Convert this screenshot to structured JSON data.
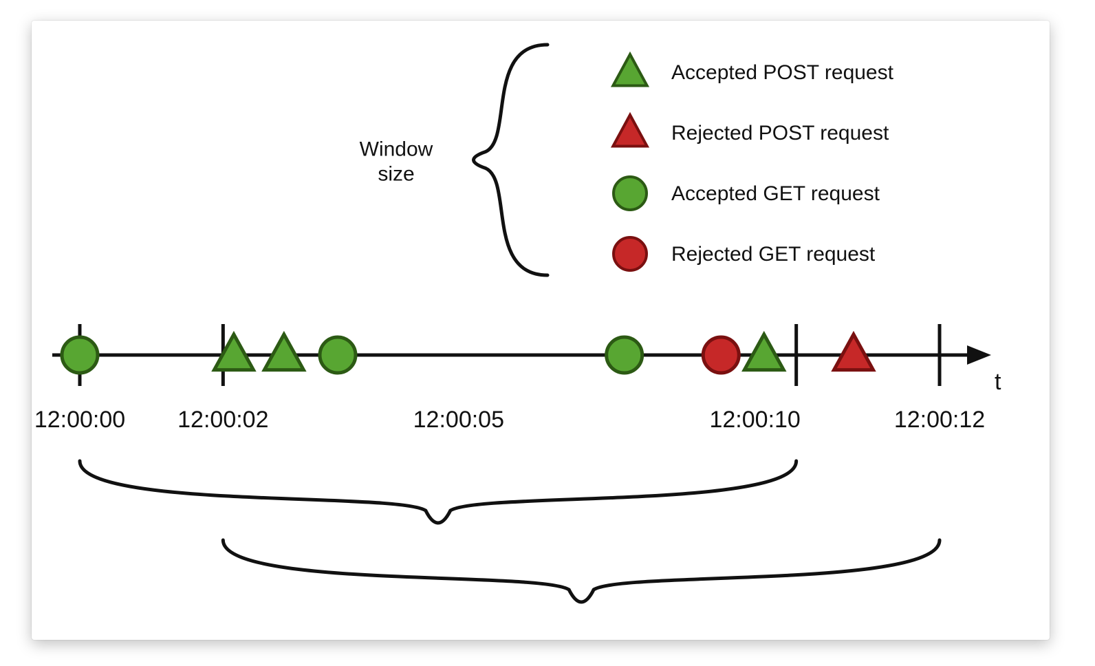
{
  "brace_label_line1": "Window",
  "brace_label_line2": "size",
  "axis_label": "t",
  "legend": [
    {
      "label": "Accepted POST request",
      "shape": "triangle",
      "fill": "#58a632",
      "stroke": "#2c5a14"
    },
    {
      "label": "Rejected POST request",
      "shape": "triangle",
      "fill": "#c62828",
      "stroke": "#7a1010"
    },
    {
      "label": "Accepted GET request",
      "shape": "circle",
      "fill": "#58a632",
      "stroke": "#2c5a14"
    },
    {
      "label": "Rejected GET request",
      "shape": "circle",
      "fill": "#c62828",
      "stroke": "#7a1010"
    }
  ],
  "ticks": [
    {
      "t": 0,
      "label": "12:00:00",
      "major": true
    },
    {
      "t": 2,
      "label": "12:00:02",
      "major": true
    },
    {
      "t": 5,
      "label": "12:00:05",
      "major": false
    },
    {
      "t": 10,
      "label": "12:00:10",
      "major": true
    },
    {
      "t": 12,
      "label": "12:00:12",
      "major": true
    }
  ],
  "events": [
    {
      "t": 0.0,
      "shape": "circle",
      "status": "accepted",
      "name": "get-accepted-1"
    },
    {
      "t": 2.15,
      "shape": "triangle",
      "status": "accepted",
      "name": "post-accepted-1"
    },
    {
      "t": 2.85,
      "shape": "triangle",
      "status": "accepted",
      "name": "post-accepted-2"
    },
    {
      "t": 3.6,
      "shape": "circle",
      "status": "accepted",
      "name": "get-accepted-2"
    },
    {
      "t": 7.6,
      "shape": "circle",
      "status": "accepted",
      "name": "get-accepted-3"
    },
    {
      "t": 8.95,
      "shape": "circle",
      "status": "rejected",
      "name": "get-rejected-1"
    },
    {
      "t": 9.55,
      "shape": "triangle",
      "status": "accepted",
      "name": "post-accepted-3"
    },
    {
      "t": 10.8,
      "shape": "triangle",
      "status": "rejected",
      "name": "post-rejected-1"
    }
  ],
  "windows": [
    {
      "from": 0,
      "to": 10,
      "name": "window-1"
    },
    {
      "from": 2,
      "to": 12,
      "name": "window-2"
    }
  ],
  "colors": {
    "accepted_fill": "#58a632",
    "accepted_stroke": "#2c5a14",
    "rejected_fill": "#c62828",
    "rejected_stroke": "#7a1010",
    "ink": "#111111"
  },
  "chart_data": {
    "type": "timeline",
    "axis": "t",
    "unit": "seconds since 12:00:00",
    "range": [
      0,
      12
    ],
    "window_size_seconds": 10,
    "ticks": [
      0,
      2,
      5,
      10,
      12
    ],
    "tick_labels": [
      "12:00:00",
      "12:00:02",
      "12:00:05",
      "12:00:10",
      "12:00:12"
    ],
    "series": [
      {
        "name": "Accepted POST request",
        "shape": "triangle",
        "color": "#58a632",
        "points_t": [
          2.15,
          2.85,
          9.55
        ]
      },
      {
        "name": "Rejected POST request",
        "shape": "triangle",
        "color": "#c62828",
        "points_t": [
          10.8
        ]
      },
      {
        "name": "Accepted GET request",
        "shape": "circle",
        "color": "#58a632",
        "points_t": [
          0.0,
          3.6,
          7.6
        ]
      },
      {
        "name": "Rejected GET request",
        "shape": "circle",
        "color": "#c62828",
        "points_t": [
          8.95
        ]
      }
    ],
    "windows": [
      {
        "from_t": 0,
        "to_t": 10
      },
      {
        "from_t": 2,
        "to_t": 12
      }
    ],
    "annotations": [
      "Window size"
    ]
  }
}
